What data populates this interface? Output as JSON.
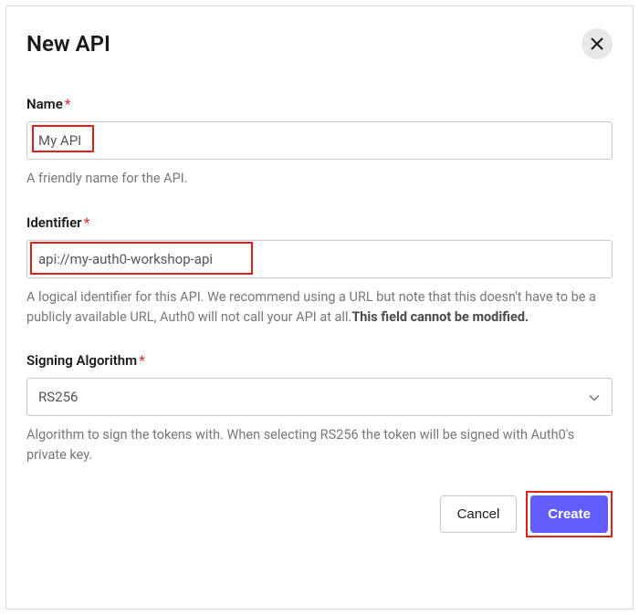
{
  "dialog": {
    "title": "New API",
    "fields": {
      "name": {
        "label": "Name",
        "required": "*",
        "value": "My API",
        "helper": "A friendly name for the API."
      },
      "identifier": {
        "label": "Identifier",
        "required": "*",
        "value": "api://my-auth0-workshop-api",
        "helper_pre": "A logical identifier for this API. We recommend using a URL but note that this doesn't have to be a publicly available URL, Auth0 will not call your API at all.",
        "helper_bold": "This field cannot be modified."
      },
      "algorithm": {
        "label": "Signing Algorithm",
        "required": "*",
        "value": "RS256",
        "helper": "Algorithm to sign the tokens with. When selecting RS256 the token will be signed with Auth0's private key."
      }
    },
    "buttons": {
      "cancel": "Cancel",
      "create": "Create"
    }
  }
}
